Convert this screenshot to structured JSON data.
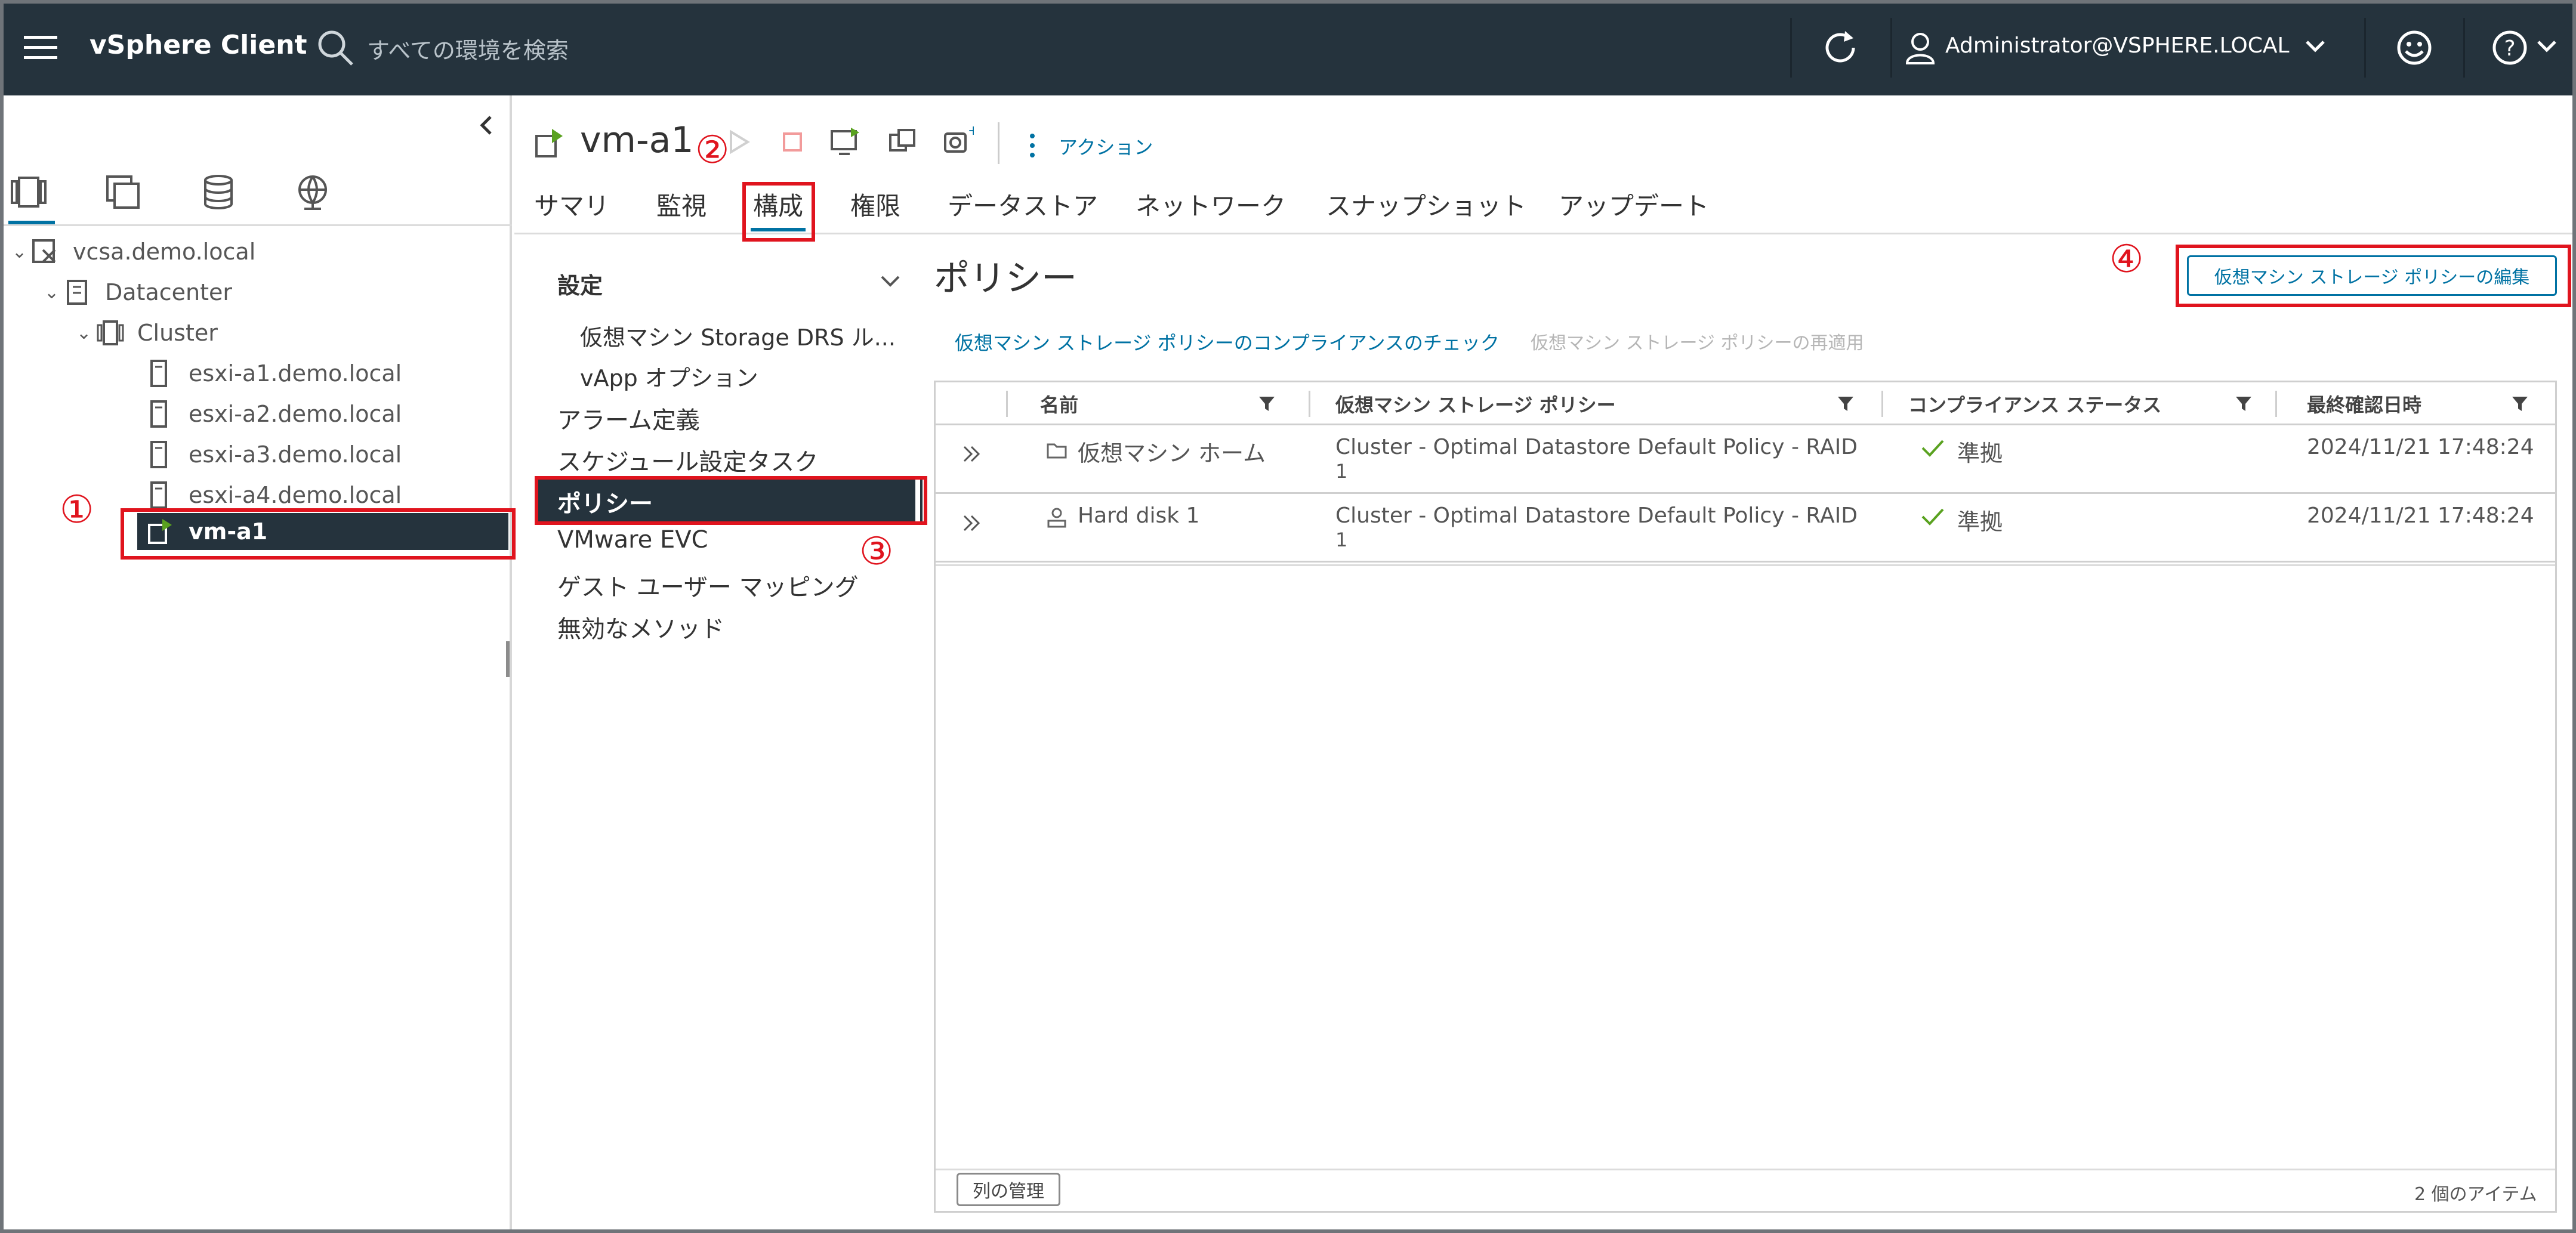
{
  "header": {
    "app_title": "vSphere Client",
    "search_placeholder": "すべての環境を検索",
    "user": "Administrator@VSPHERE.LOCAL"
  },
  "tree": {
    "items": [
      {
        "label": "vcsa.demo.local"
      },
      {
        "label": "Datacenter"
      },
      {
        "label": "Cluster"
      },
      {
        "label": "esxi-a1.demo.local"
      },
      {
        "label": "esxi-a2.demo.local"
      },
      {
        "label": "esxi-a3.demo.local"
      },
      {
        "label": "esxi-a4.demo.local"
      },
      {
        "label": "vm-a1"
      }
    ]
  },
  "object": {
    "title": "vm-a1",
    "actions_label": "アクション",
    "tabs": [
      "サマリ",
      "監視",
      "構成",
      "権限",
      "データストア",
      "ネットワーク",
      "スナップショット",
      "アップデート"
    ]
  },
  "settings_nav": {
    "section": "設定",
    "items": [
      "仮想マシン Storage DRS ル...",
      "vApp オプション",
      "アラーム定義",
      "スケジュール設定タスク",
      "ポリシー",
      "VMware EVC",
      "ゲスト ユーザー マッピング",
      "無効なメソッド"
    ]
  },
  "main": {
    "title": "ポリシー",
    "edit_button": "仮想マシン ストレージ ポリシーの編集",
    "check_link": "仮想マシン ストレージ ポリシーのコンプライアンスのチェック",
    "reapply_link": "仮想マシン ストレージ ポリシーの再適用",
    "columns": [
      "名前",
      "仮想マシン ストレージ ポリシー",
      "コンプライアンス ステータス",
      "最終確認日時"
    ],
    "rows": [
      {
        "name": "仮想マシン ホーム",
        "policy_line1": "Cluster - Optimal Datastore Default Policy - RAID",
        "policy_line2": "1",
        "status": "準拠",
        "date": "2024/11/21 17:48:24"
      },
      {
        "name": "Hard disk 1",
        "policy_line1": "Cluster - Optimal Datastore Default Policy - RAID",
        "policy_line2": "1",
        "status": "準拠",
        "date": "2024/11/21 17:48:24"
      }
    ],
    "manage_columns": "列の管理",
    "item_count": "2 個のアイテム"
  },
  "annotations": [
    "①",
    "②",
    "③",
    "④"
  ],
  "colors": {
    "header_bg": "#25333d",
    "selected_bg": "#25333d",
    "link": "#0072a3",
    "highlight": "#e0141e",
    "check": "#5aa220"
  }
}
